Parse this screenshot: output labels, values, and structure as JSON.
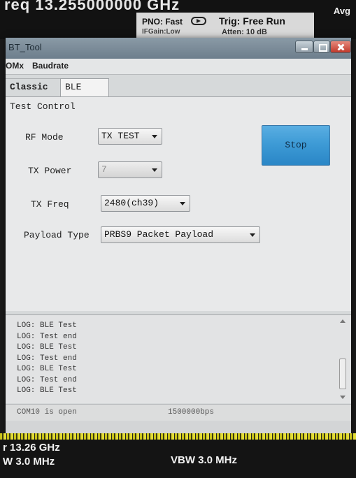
{
  "analyzer": {
    "center_freq_top": "req 13.255000000 GHz",
    "pno": "PNO: Fast",
    "if_gain": "IFGain:Low",
    "trig": "Trig: Free Run",
    "atten": "Atten: 10 dB",
    "avg": "Avg",
    "center_freq_bottom": "r 13.26 GHz",
    "rbw": "W 3.0 MHz",
    "vbw": "VBW 3.0 MHz"
  },
  "window": {
    "title": "BT_Tool"
  },
  "menu": [
    "OMx",
    "Baudrate"
  ],
  "tabs": [
    {
      "label": "Classic",
      "active": false
    },
    {
      "label": "BLE",
      "active": true
    }
  ],
  "test_control": {
    "title": "Test Control",
    "rf_mode": {
      "label": "RF Mode",
      "value": "TX TEST"
    },
    "tx_power": {
      "label": "TX Power",
      "value": "7"
    },
    "tx_freq": {
      "label": "TX Freq",
      "value": "2480(ch39)"
    },
    "payload_type": {
      "label": "Payload Type",
      "value": "PRBS9 Packet Payload"
    },
    "stop_label": "Stop"
  },
  "log": [
    "LOG: BLE Test",
    "LOG: Test end",
    "LOG: BLE Test",
    "LOG: Test end",
    "LOG: BLE Test",
    "LOG: Test end",
    "LOG: BLE Test"
  ],
  "status": {
    "port": "COM10 is open",
    "baud": "1500000bps"
  },
  "colors": {
    "stop_button": "#3e9bd6",
    "close_button": "#c0392b",
    "trace": "#e3dc35"
  }
}
